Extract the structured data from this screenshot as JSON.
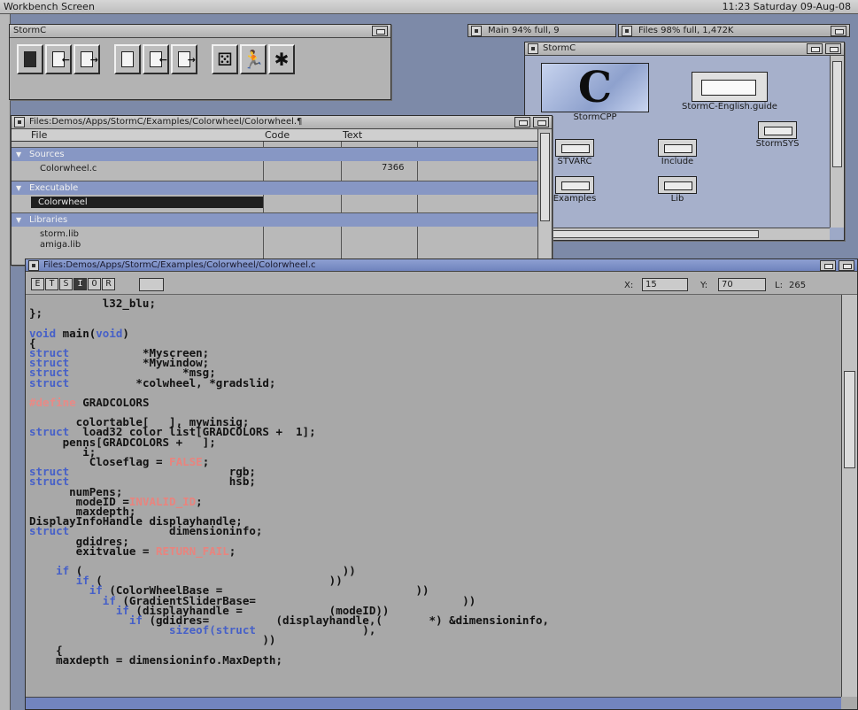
{
  "screen": {
    "title": "Workbench Screen",
    "clock": "11:23 Saturday 09-Aug-08"
  },
  "volumes": {
    "main": "Main  94% full, 9",
    "files": "Files  98% full, 1,472K"
  },
  "toolbar_window": {
    "title": "StormC",
    "buttons": [
      {
        "name": "new-icon"
      },
      {
        "name": "load-icon"
      },
      {
        "name": "save-icon"
      },
      {
        "name": "new-project-icon"
      },
      {
        "name": "load-project-icon"
      },
      {
        "name": "save-project-icon"
      },
      {
        "name": "make-icon"
      },
      {
        "name": "run-icon"
      },
      {
        "name": "debug-icon"
      }
    ]
  },
  "drawer_window": {
    "title": "StormC",
    "icons": [
      {
        "label": "StormCPP"
      },
      {
        "label": "StormC-English.guide"
      },
      {
        "label": "StormSYS"
      },
      {
        "label": "STVARC"
      },
      {
        "label": "Include"
      },
      {
        "label": "Examples"
      },
      {
        "label": "Lib"
      }
    ]
  },
  "project_window": {
    "title": "Files:Demos/Apps/StormC/Examples/Colorwheel/Colorwheel.¶",
    "columns": {
      "file": "File",
      "code": "Code",
      "text": "Text"
    },
    "sections": [
      {
        "label": "Sources",
        "items": [
          {
            "name": "Colorwheel.c",
            "text": "7366"
          }
        ]
      },
      {
        "label": "Executable",
        "items": [
          {
            "name": "Colorwheel"
          }
        ]
      },
      {
        "label": "Libraries",
        "items": [
          {
            "name": "storm.lib"
          },
          {
            "name": "amiga.lib"
          }
        ]
      }
    ]
  },
  "editor_window": {
    "title": "Files:Demos/Apps/StormC/Examples/Colorwheel/Colorwheel.c",
    "modes": [
      "E",
      "T",
      "S",
      "I",
      "O",
      "R"
    ],
    "x_label": "X:",
    "x_value": "15",
    "y_label": "Y:",
    "y_value": "70",
    "l_label": "L:",
    "l_value": "265"
  },
  "colors": {
    "keyword": "#4660c8",
    "define": "#e88a86",
    "constant": "#e8847e",
    "selection": "#1f1f1f",
    "active_title": "#7d91c8"
  }
}
